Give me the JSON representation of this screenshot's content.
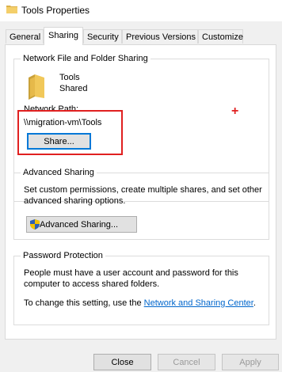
{
  "window": {
    "title": "Tools Properties",
    "folder_icon": "folder-icon"
  },
  "tabs": [
    {
      "label": "General"
    },
    {
      "label": "Sharing"
    },
    {
      "label": "Security"
    },
    {
      "label": "Previous Versions"
    },
    {
      "label": "Customize"
    }
  ],
  "network_sharing": {
    "group_label": "Network File and Folder Sharing",
    "item_name": "Tools",
    "item_status": "Shared",
    "path_label": "Network Path:",
    "path_value": "\\\\migration-vm\\Tools",
    "share_button": "Share..."
  },
  "advanced_sharing": {
    "group_label": "Advanced Sharing",
    "description_line1": "Set custom permissions, create multiple shares, and set other",
    "description_line2": "advanced sharing options.",
    "button_label": "Advanced Sharing...",
    "button_icon": "uac-shield-icon"
  },
  "password_protection": {
    "group_label": "Password Protection",
    "line1": "People must have a user account and password for this",
    "line2": "computer to access shared folders.",
    "change_prefix": "To change this setting, use the ",
    "link_text": "Network and Sharing Center",
    "change_suffix": "."
  },
  "footer": {
    "close": "Close",
    "cancel": "Cancel",
    "apply": "Apply"
  },
  "annotations": {
    "marker": "+",
    "highlight_color": "#e02020"
  }
}
